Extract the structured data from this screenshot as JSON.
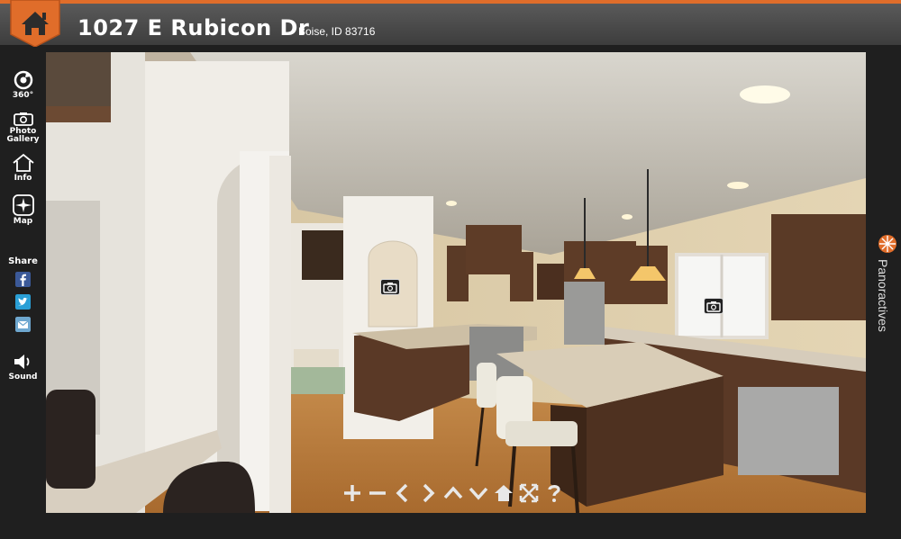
{
  "header": {
    "address": "1027 E Rubicon Dr",
    "city_line": "Boise, ID 83716"
  },
  "sidebar": {
    "items": [
      {
        "label": "360°",
        "icon": "360-icon"
      },
      {
        "label": "Photo\nGallery",
        "icon": "camera-icon"
      },
      {
        "label": "Info",
        "icon": "house-icon"
      },
      {
        "label": "Map",
        "icon": "compass-icon"
      }
    ],
    "share_label": "Share",
    "share_buttons": [
      "facebook-icon",
      "twitter-icon",
      "email-icon"
    ],
    "sound_label": "Sound"
  },
  "viewer": {
    "controls": [
      "zoom-in-icon",
      "zoom-out-icon",
      "pan-left-icon",
      "pan-right-icon",
      "pan-up-icon",
      "pan-down-icon",
      "home-icon",
      "fullscreen-icon",
      "help-icon"
    ]
  },
  "brand": {
    "name": "Panoractives"
  },
  "colors": {
    "accent": "#e06d2a",
    "header": "#4a4a4a",
    "background": "#1f1f1f"
  }
}
